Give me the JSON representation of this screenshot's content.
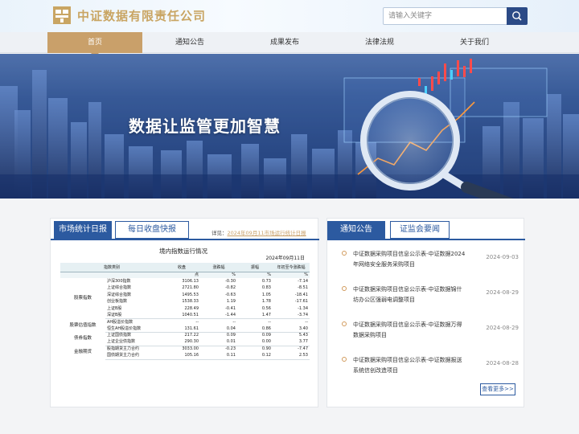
{
  "header": {
    "company_name": "中证数据有限责任公司",
    "search_placeholder": "请输入关键字"
  },
  "nav": {
    "items": [
      {
        "label": "首页",
        "active": true
      },
      {
        "label": "通知公告",
        "active": false
      },
      {
        "label": "成果发布",
        "active": false
      },
      {
        "label": "法律法规",
        "active": false
      },
      {
        "label": "关于我们",
        "active": false
      }
    ]
  },
  "banner": {
    "slogan": "数据让监管更加智慧"
  },
  "market": {
    "tab_active": "市场统计日报",
    "tab_other": "每日收盘快报",
    "report_prefix": "详见：",
    "report_link": "2024年09月11市场运行统计日报",
    "table_title": "境内指数运行情况",
    "table_date": "2024年09月11日",
    "headers": [
      "指数类别",
      "收盘",
      "涨跌幅",
      "振幅",
      "年初至今涨跌幅"
    ],
    "units": [
      "",
      "点",
      "%",
      "%",
      "%"
    ],
    "groups": [
      {
        "name": "股票指数",
        "rows": [
          [
            "沪深300指数",
            "3106.13",
            "-0.30",
            "0.73",
            "-7.14"
          ],
          [
            "上证综合指数",
            "2721.80",
            "-0.82",
            "0.83",
            "-8.51"
          ],
          [
            "深证综合指数",
            "1495.53",
            "-0.63",
            "1.05",
            "-18.41"
          ],
          [
            "创业板指数",
            "1538.33",
            "1.19",
            "1.78",
            "-17.61"
          ],
          [
            "上证B股",
            "228.49",
            "-0.41",
            "0.56",
            "-1.34"
          ],
          [
            "深证B股",
            "1040.51",
            "-1.44",
            "1.47",
            "-3.74"
          ]
        ]
      },
      {
        "name": "股票估值指数",
        "rows": [
          [
            "AH股溢价指数",
            "--",
            "--",
            "--",
            "--"
          ],
          [
            "恒生AH股溢价指数",
            "131.61",
            "0.04",
            "0.86",
            "3.40"
          ]
        ]
      },
      {
        "name": "债券指数",
        "rows": [
          [
            "上证国债指数",
            "217.22",
            "0.09",
            "0.09",
            "5.43"
          ],
          [
            "上证企业债指数",
            "290.30",
            "0.01",
            "0.00",
            "3.77"
          ]
        ]
      },
      {
        "name": "金融期货",
        "rows": [
          [
            "股指期货主力合约",
            "3033.00",
            "-0.23",
            "0.90",
            "-7.47"
          ],
          [
            "国债期货主力合约",
            "105.16",
            "0.11",
            "0.12",
            "2.53"
          ]
        ]
      }
    ]
  },
  "notices": {
    "tab_active": "通知公告",
    "tab_other": "证监会要闻",
    "items": [
      {
        "title": "中证数据采购项目信息公示表-中证数据2024年网络安全服务采购项目",
        "date": "2024-09-03"
      },
      {
        "title": "中证数据采购项目信息公示表-中证数据锦什坊办公区强弱电调整项目",
        "date": "2024-08-29"
      },
      {
        "title": "中证数据采购项目信息公示表-中证数据万得数据采购项目",
        "date": "2024-08-29"
      },
      {
        "title": "中证数据采购项目信息公示表-中证数据报送系统信创改造项目",
        "date": "2024-08-28"
      }
    ],
    "more_label": "查看更多>>"
  },
  "colors": {
    "primary": "#2c5aa0",
    "accent": "#c9a06a",
    "nav_bg": "#eef1f5"
  }
}
